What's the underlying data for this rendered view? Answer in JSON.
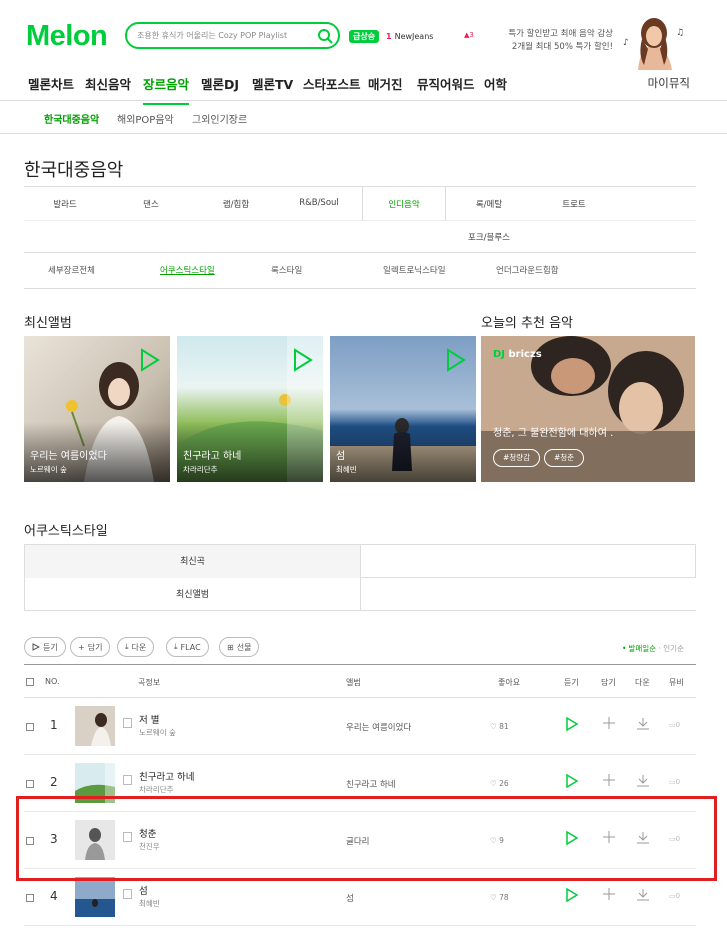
{
  "header": {
    "logo": "Melon",
    "search_placeholder": "조용한 휴식가 어울리는 Cozy POP Playlist",
    "rising_badge": "급상승",
    "rising_rank": "1",
    "rising_item": "NewJeans",
    "rising_change": "3",
    "promo_line1": "특가 할인받고 최애 음악 감상",
    "promo_line2": "2개월 최대 50% 특가 할인!"
  },
  "gnb": {
    "items": [
      "멜론차트",
      "최신음악",
      "장르음악",
      "멜론DJ",
      "멜론TV",
      "스타포스트",
      "매거진",
      "뮤직어워드",
      "어학"
    ],
    "active_index": 2,
    "my_music": "마이뮤직"
  },
  "sub_nav": {
    "items": [
      "한국대중음악",
      "해외POP음악",
      "그외인기장르"
    ],
    "active_index": 0
  },
  "page_title": "한국대중음악",
  "genres": {
    "row1": [
      "발라드",
      "댄스",
      "랩/힙합",
      "R&B/Soul",
      "인디음악",
      "록/메탈",
      "트로트"
    ],
    "row2": [
      "포크/블루스"
    ],
    "active": "인디음악"
  },
  "styles": {
    "items": [
      "세부장르전체",
      "어쿠스틱스타일",
      "록스타일",
      "일렉트로닉스타일",
      "언더그라운드힙합"
    ],
    "active_index": 1
  },
  "latest_albums": {
    "title": "최신앨범",
    "items": [
      {
        "title": "우리는 여름이었다",
        "artist": "노르웨이 숲"
      },
      {
        "title": "친구라고 하네",
        "artist": "차라리단추"
      },
      {
        "title": "섬",
        "artist": "최혜빈"
      }
    ]
  },
  "recommend": {
    "title": "오늘의 추천 음악",
    "dj": "briczs",
    "text": "청춘, 그 불완전함에 대하여 .",
    "tags": [
      "#청량감",
      "#청춘"
    ]
  },
  "acoustic": {
    "title": "어쿠스틱스타일",
    "tabs": [
      "최신곡",
      "최신앨범"
    ]
  },
  "toolbar": {
    "buttons": [
      "듣기",
      "담기",
      "다운",
      "FLAC",
      "선물"
    ],
    "sort": [
      "발매일순",
      "인기순"
    ]
  },
  "table": {
    "headers": {
      "no": "NO.",
      "song": "곡정보",
      "album": "앨범",
      "like": "좋아요",
      "listen": "듣기",
      "add": "담기",
      "down": "다운",
      "mv": "뮤비"
    },
    "rows": [
      {
        "no": "1",
        "song": "저 별",
        "artist": "노르웨이 숲",
        "album": "우리는 여름이었다",
        "likes": "81",
        "mv": "0"
      },
      {
        "no": "2",
        "song": "친구라고 하네",
        "artist": "차라리단추",
        "album": "친구라고 하네",
        "likes": "26",
        "mv": "0"
      },
      {
        "no": "3",
        "song": "청춘",
        "artist": "천진우",
        "album": "글다리",
        "likes": "9",
        "mv": "0"
      },
      {
        "no": "4",
        "song": "섬",
        "artist": "최혜빈",
        "album": "섬",
        "likes": "78",
        "mv": "0"
      }
    ]
  },
  "colors": {
    "accent": "#00cd3c",
    "highlight": "#e02020"
  }
}
